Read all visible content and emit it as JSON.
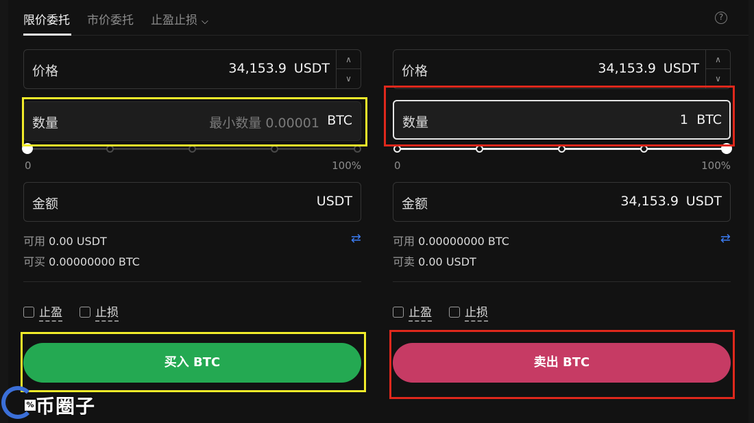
{
  "tabs": {
    "items": [
      {
        "label": "限价委托"
      },
      {
        "label": "市价委托"
      },
      {
        "label": "止盈止损"
      }
    ],
    "help": "?"
  },
  "buy": {
    "price": {
      "label": "价格",
      "value": "34,153.9",
      "unit": "USDT"
    },
    "quantity": {
      "label": "数量",
      "value": "",
      "placeholder": "最小数量 0.00001",
      "unit": "BTC"
    },
    "slider": {
      "min_label": "0",
      "max_label": "100%",
      "fraction": 0
    },
    "amount": {
      "label": "金额",
      "value": "",
      "unit": "USDT"
    },
    "available": {
      "label": "可用",
      "value": "0.00 USDT"
    },
    "can_trade": {
      "label": "可买",
      "value": "0.00000000 BTC"
    },
    "take_profit": "止盈",
    "stop_loss": "止损",
    "button": "买入 BTC",
    "color": "#24a952"
  },
  "sell": {
    "price": {
      "label": "价格",
      "value": "34,153.9",
      "unit": "USDT"
    },
    "quantity": {
      "label": "数量",
      "value": "1",
      "placeholder": "",
      "unit": "BTC"
    },
    "slider": {
      "min_label": "0",
      "max_label": "100%",
      "fraction": 1
    },
    "amount": {
      "label": "金额",
      "value": "34,153.9",
      "unit": "USDT"
    },
    "available": {
      "label": "可用",
      "value": "0.00000000 BTC"
    },
    "can_trade": {
      "label": "可卖",
      "value": "0.00 USDT"
    },
    "take_profit": "止盈",
    "stop_loss": "止损",
    "button": "卖出 BTC",
    "color": "#c63b64"
  },
  "icons": {
    "swap": "swap-arrows-icon",
    "stepper_up": "chevron-up-icon",
    "stepper_down": "chevron-down-icon",
    "dropdown": "chevron-down-icon"
  },
  "watermark": {
    "text": "币圈子"
  }
}
